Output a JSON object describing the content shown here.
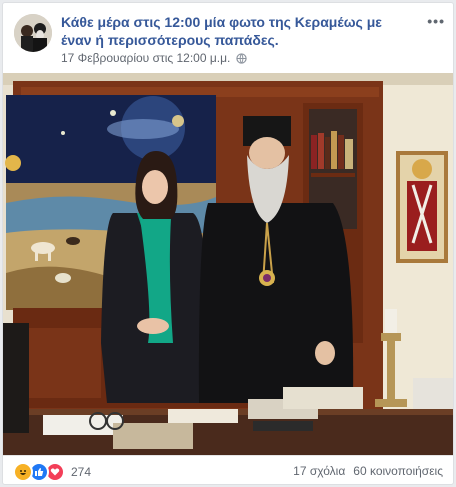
{
  "post": {
    "title": "Κάθε μέρα στις 12:00 μία φωτο της Κεραμέως με έναν ή περισσότερους παπάδες.",
    "timestamp": "17 Φεβρουαρίου στις 12:00 μ.μ.",
    "visibility_icon": "globe-icon",
    "more_label": "•••"
  },
  "photo": {
    "description_icon": "photo"
  },
  "footer": {
    "reaction_icons": [
      "haha-icon",
      "like-icon",
      "love-icon"
    ],
    "reaction_count": "274",
    "comments": "17 σχόλια",
    "shares": "60 κοινοποιήσεις"
  },
  "colors": {
    "link": "#365899",
    "meta": "#616770",
    "like": "#2078f4",
    "love": "#f33e58",
    "haha": "#f7b125"
  }
}
